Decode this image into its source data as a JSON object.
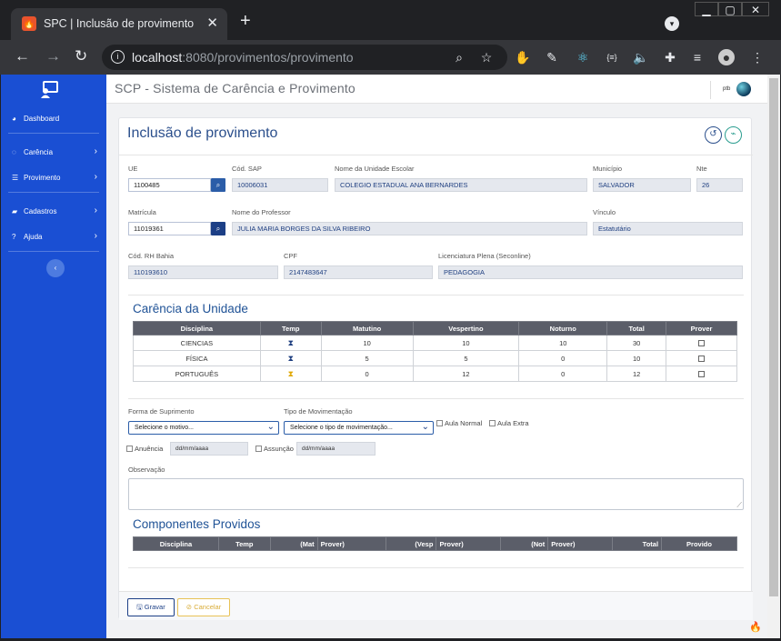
{
  "browser": {
    "tab_title": "SPC | Inclusão de provimento",
    "close_glyph": "✕",
    "new_tab_glyph": "+",
    "url_host": "localhost",
    "url_path": ":8080/provimentos/provimento"
  },
  "header": {
    "app_title": "SCP - Sistema de Carência e Provimento",
    "lang": "ptb"
  },
  "sidebar": {
    "items": [
      {
        "label": "Dashboard",
        "icon": "dashboard-icon"
      },
      {
        "label": "Carência",
        "icon": "circle-icon"
      },
      {
        "label": "Provimento",
        "icon": "list-icon"
      },
      {
        "label": "Cadastros",
        "icon": "folder-icon"
      },
      {
        "label": "Ajuda",
        "icon": "question-icon"
      }
    ],
    "collapse_glyph": "‹"
  },
  "form": {
    "title": "Inclusão de provimento",
    "fields": {
      "ue": {
        "label": "UE",
        "value": "1100485"
      },
      "cod_sap": {
        "label": "Cód. SAP",
        "value": "10006031"
      },
      "unidade": {
        "label": "Nome da Unidade Escolar",
        "value": "COLEGIO ESTADUAL ANA BERNARDES"
      },
      "municipio": {
        "label": "Município",
        "value": "SALVADOR"
      },
      "nte": {
        "label": "Nte",
        "value": "26"
      },
      "matricula": {
        "label": "Matrícula",
        "value": "11019361"
      },
      "professor": {
        "label": "Nome do Professor",
        "value": "JULIA MARIA BORGES DA SILVA RIBEIRO"
      },
      "vinculo": {
        "label": "Vínculo",
        "value": "Estatutário"
      },
      "cod_rh": {
        "label": "Cód. RH Bahia",
        "value": "110193610"
      },
      "cpf": {
        "label": "CPF",
        "value": "2147483647"
      },
      "licenciatura": {
        "label": "Licenciatura Plena (Seconline)",
        "value": "PEDAGOGIA"
      }
    }
  },
  "carencia": {
    "title": "Carência da Unidade",
    "headers": [
      "Disciplina",
      "Temp",
      "Matutino",
      "Vespertino",
      "Noturno",
      "Total",
      "Prover"
    ],
    "rows": [
      {
        "disciplina": "CIENCIAS",
        "temp": "⧗",
        "temp_color": "#1f3f80",
        "mat": "10",
        "vesp": "10",
        "not": "10",
        "total": "30"
      },
      {
        "disciplina": "FÍSICA",
        "temp": "⧗",
        "temp_color": "#1f3f80",
        "mat": "5",
        "vesp": "5",
        "not": "0",
        "total": "10"
      },
      {
        "disciplina": "PORTUGUÊS",
        "temp": "⧗",
        "temp_color": "#e0a800",
        "mat": "0",
        "vesp": "12",
        "not": "0",
        "total": "12"
      }
    ]
  },
  "suprimento": {
    "forma_label": "Forma de Suprimento",
    "forma_value": "Selecione o motivo...",
    "tipo_label": "Tipo de Movimentação",
    "tipo_value": "Selecione o tipo de movimentação...",
    "aula_normal": "Aula Normal",
    "aula_extra": "Aula Extra",
    "anuencia": "Anuência",
    "anuencia_date": "dd/mm/aaaa",
    "assuncao": "Assunção",
    "assuncao_date": "dd/mm/aaaa",
    "observacao": "Observação"
  },
  "providos": {
    "title": "Componentes Providos",
    "headers": [
      "Disciplina",
      "Temp",
      "(Mat",
      "Prover)",
      "(Vesp",
      "Prover)",
      "(Not",
      "Prover)",
      "Total",
      "Provido"
    ]
  },
  "footer": {
    "save": "Gravar",
    "cancel": "Cancelar"
  },
  "colors": {
    "sidebar": "#1a4fd3",
    "accent": "#1f5296",
    "save_border": "#1c3f86",
    "cancel_border": "#e8c256"
  }
}
